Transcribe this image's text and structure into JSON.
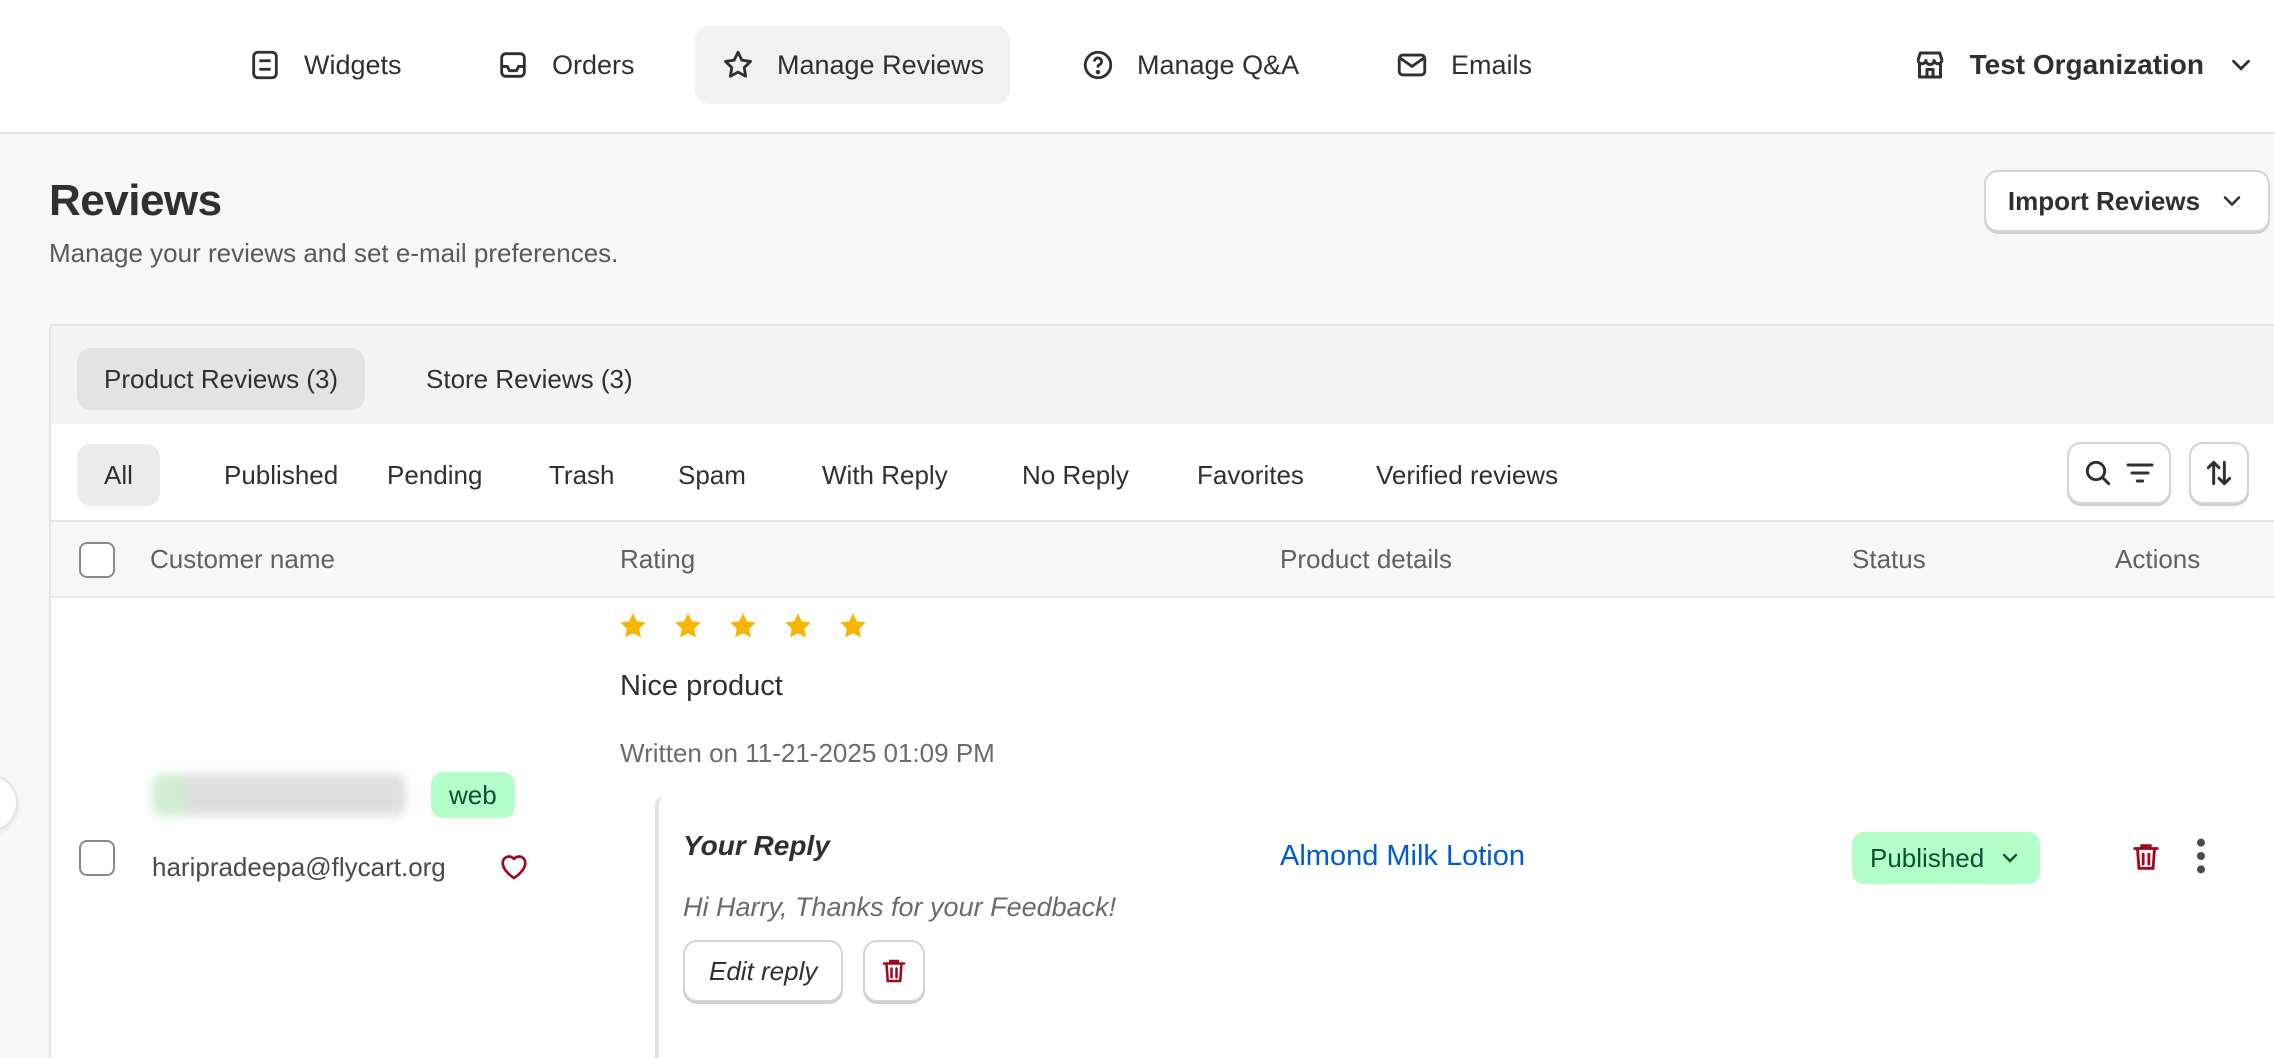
{
  "nav": {
    "items": [
      {
        "label": "Widgets",
        "icon": "widgets-icon"
      },
      {
        "label": "Orders",
        "icon": "inbox-icon"
      },
      {
        "label": "Manage Reviews",
        "icon": "star-icon",
        "active": true
      },
      {
        "label": "Manage Q&A",
        "icon": "question-circle-icon"
      },
      {
        "label": "Emails",
        "icon": "mail-icon"
      }
    ],
    "org_name": "Test Organization"
  },
  "header": {
    "title": "Reviews",
    "subtitle": "Manage your reviews and set e-mail preferences.",
    "import_label": "Import Reviews"
  },
  "tabs": [
    "Product Reviews (3)",
    "Store Reviews (3)"
  ],
  "filters": [
    "All",
    "Published",
    "Pending",
    "Trash",
    "Spam",
    "With Reply",
    "No Reply",
    "Favorites",
    "Verified reviews"
  ],
  "table": {
    "columns": [
      "Customer name",
      "Rating",
      "Product details",
      "Status",
      "Actions"
    ],
    "rows": [
      {
        "source_badge": "web",
        "email": "haripradeepa@flycart.org",
        "rating": 5,
        "max_rating": 5,
        "review_title": "Nice product",
        "date": "Written on 11-21-2025 01:09 PM",
        "reply_heading": "Your Reply",
        "reply_text": "Hi Harry, Thanks for your Feedback!",
        "edit_reply_label": "Edit reply",
        "product": "Almond Milk Lotion",
        "status": "Published"
      }
    ]
  },
  "colors": {
    "accent_link": "#005bd3",
    "star": "#f7b500",
    "success_bg": "#b4fec9",
    "success_text": "#0c5132",
    "danger": "#a1081f"
  }
}
